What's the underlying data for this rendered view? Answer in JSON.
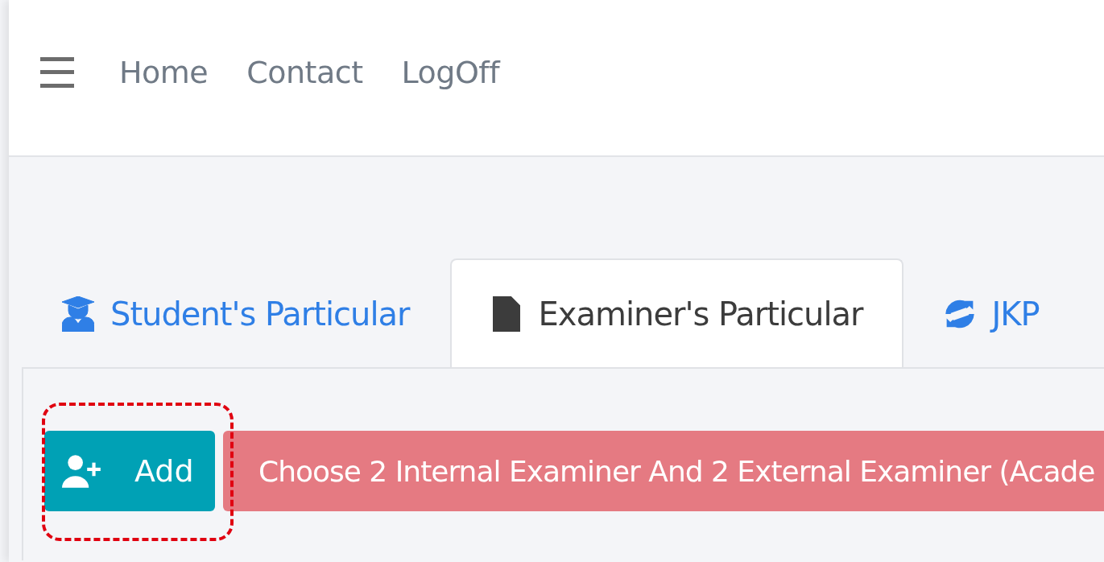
{
  "nav": {
    "links": [
      "Home",
      "Contact",
      "LogOff"
    ]
  },
  "tabs": [
    {
      "label": "Student's Particular",
      "kind": "student",
      "selected": false
    },
    {
      "label": "Examiner's Particular",
      "kind": "document",
      "selected": true
    },
    {
      "label": "JKP",
      "kind": "sync",
      "selected": false
    }
  ],
  "add_button": {
    "label": "Add"
  },
  "alert": {
    "text": "Choose 2 Internal Examiner And 2 External Examiner (Acade"
  }
}
